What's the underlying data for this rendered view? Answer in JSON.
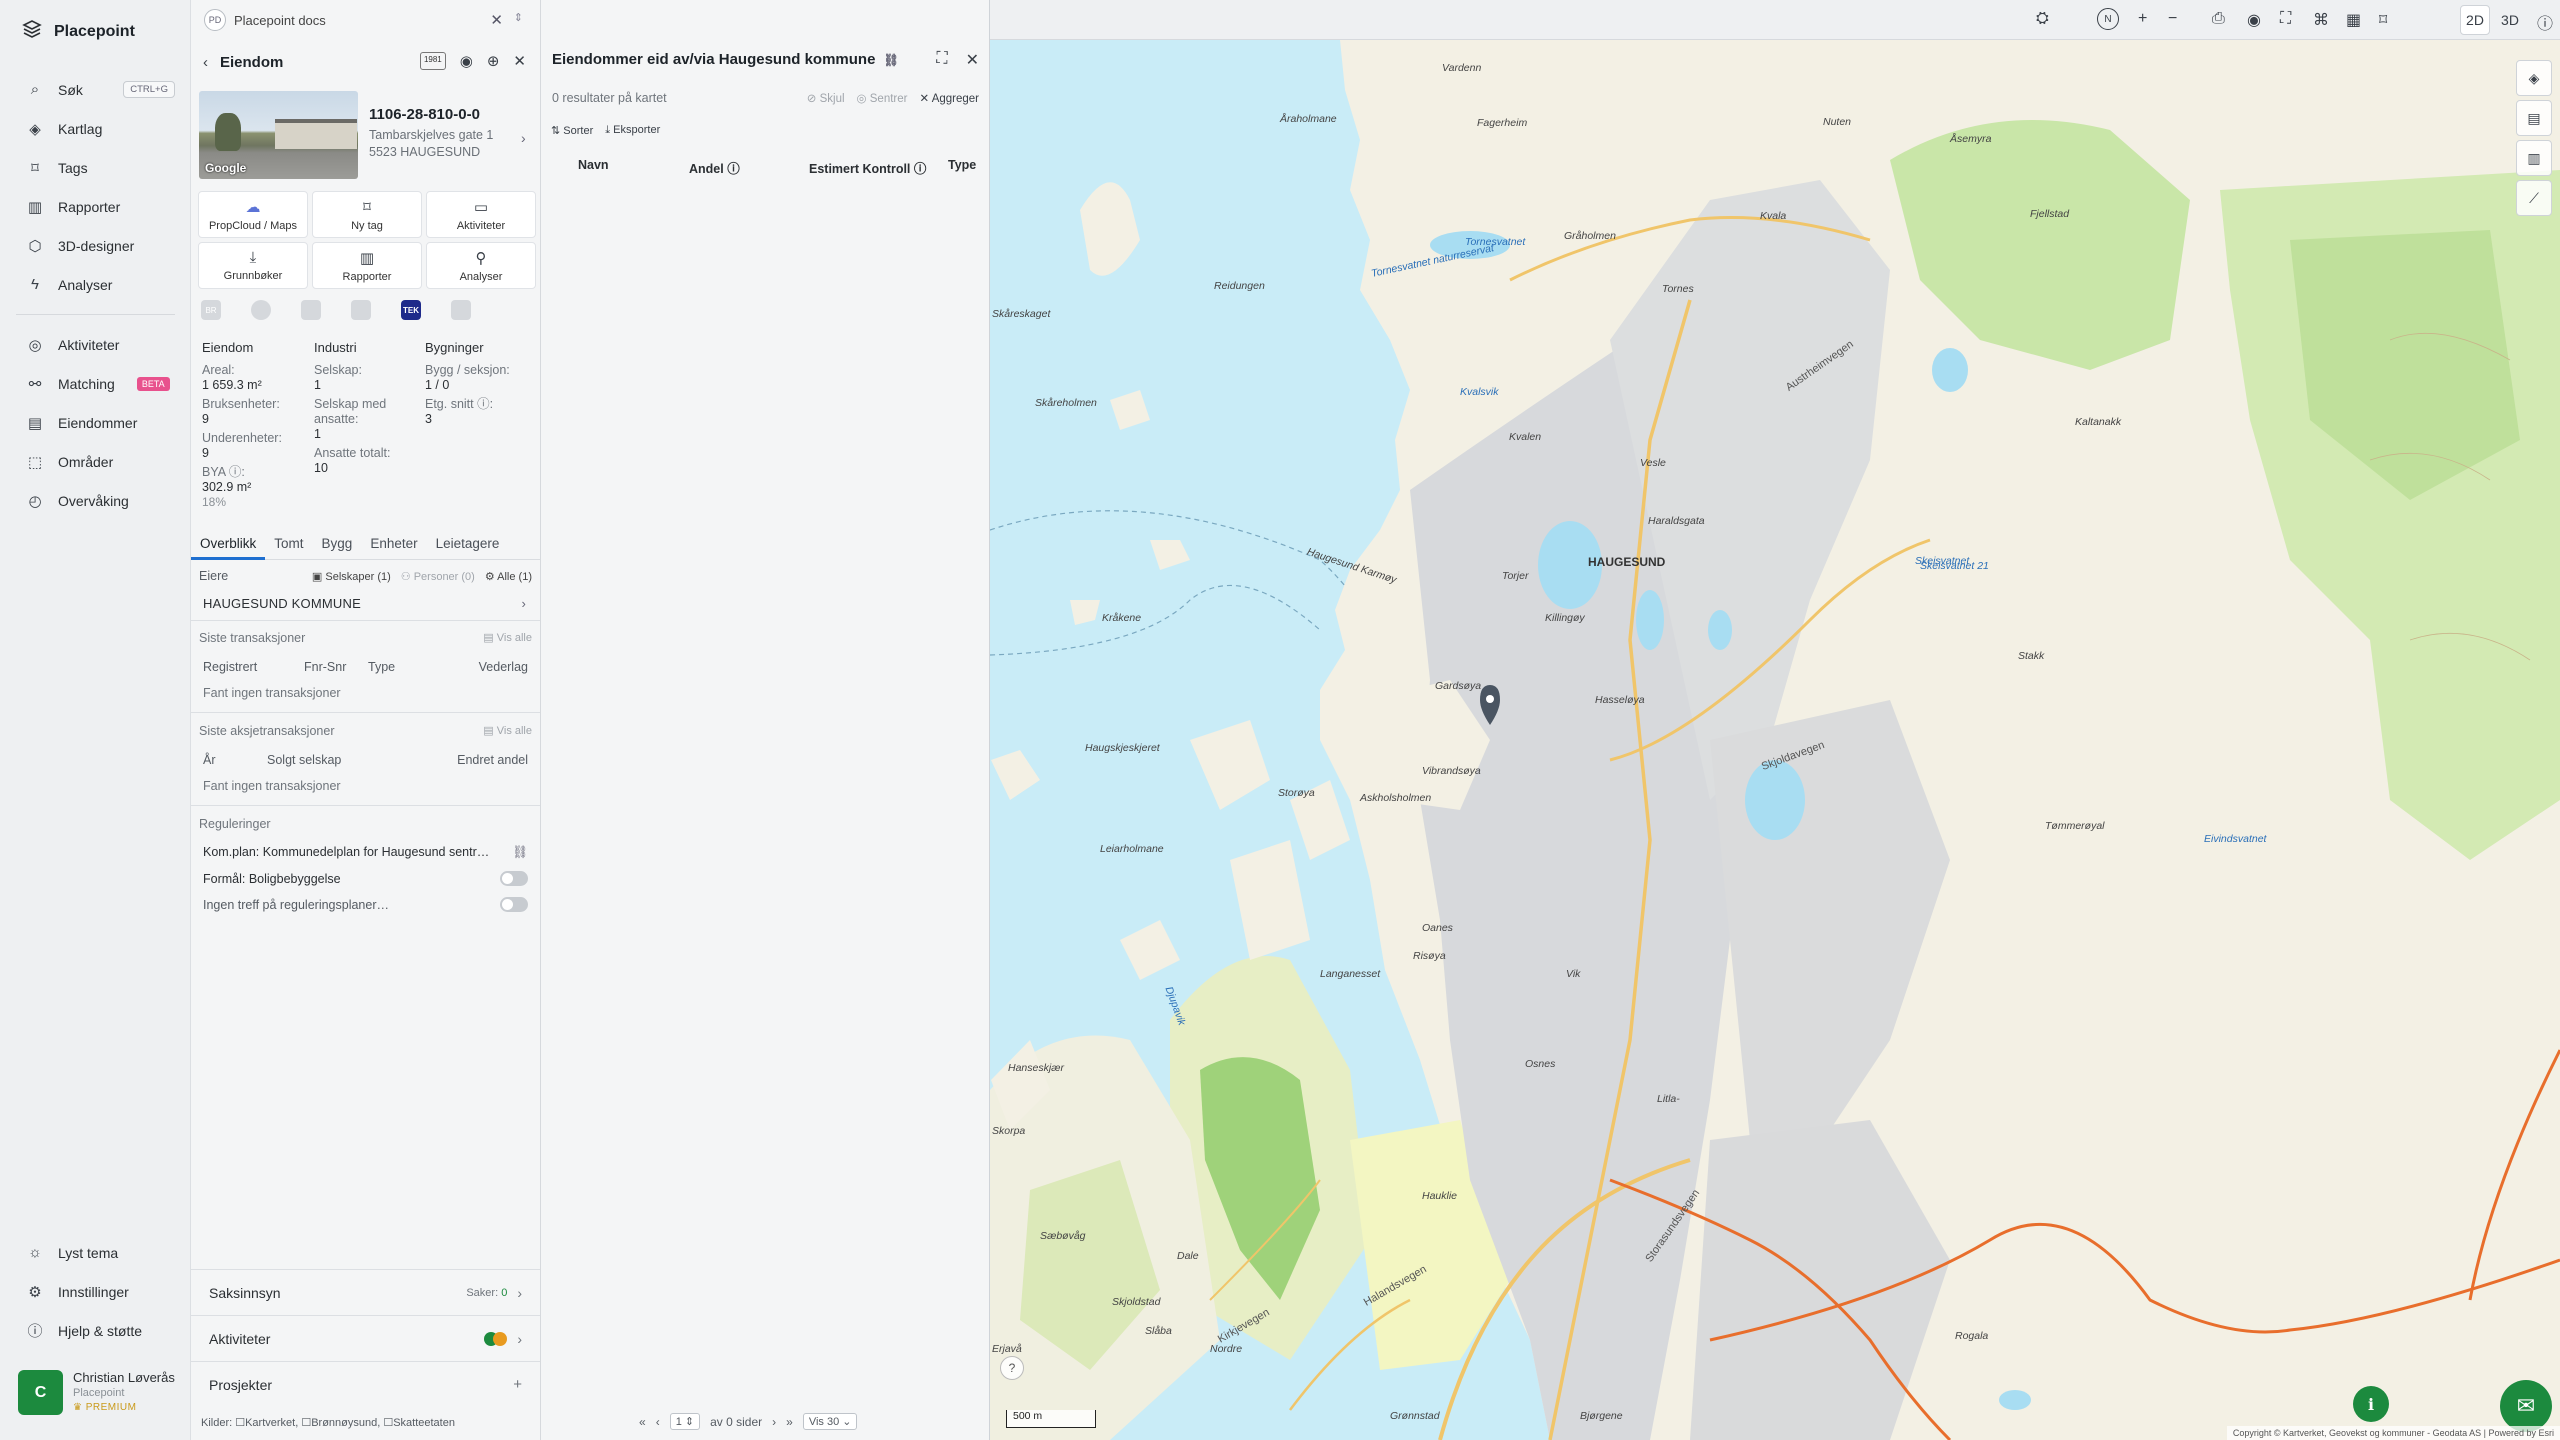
{
  "app": {
    "name": "Placepoint"
  },
  "nav": {
    "items": [
      {
        "label": "Søk",
        "icon": "search-icon",
        "shortcut": "CTRL+G"
      },
      {
        "label": "Kartlag",
        "icon": "layers-icon"
      },
      {
        "label": "Tags",
        "icon": "bookmark-icon"
      },
      {
        "label": "Rapporter",
        "icon": "chart-icon"
      },
      {
        "label": "3D-designer",
        "icon": "cube-icon"
      },
      {
        "label": "Analyser",
        "icon": "bolt-icon"
      }
    ],
    "items2": [
      {
        "label": "Aktiviteter",
        "icon": "activity-icon"
      },
      {
        "label": "Matching",
        "icon": "matching-icon",
        "badge": "BETA"
      },
      {
        "label": "Eiendommer",
        "icon": "building-icon"
      },
      {
        "label": "Områder",
        "icon": "area-icon"
      },
      {
        "label": "Overvåking",
        "icon": "monitor-icon"
      }
    ],
    "bottom": [
      {
        "label": "Lyst tema",
        "icon": "sun-icon"
      },
      {
        "label": "Innstillinger",
        "icon": "gear-icon"
      },
      {
        "label": "Hjelp & støtte",
        "icon": "help-icon"
      }
    ],
    "user": {
      "initial": "C",
      "name": "Christian Løverås",
      "org": "Placepoint",
      "plan": "PREMIUM"
    }
  },
  "doc_tab": {
    "badge": "PD",
    "title": "Placepoint docs"
  },
  "property": {
    "header": "Eiendom",
    "year_tag": "1981",
    "thumb_brand": "Google",
    "gnr": "1106-28-810-0-0",
    "street": "Tambarskjelves gate 1",
    "postal": "5523 HAUGESUND",
    "actions": [
      {
        "label": "PropCloud / Maps",
        "icon": "cloud-icon"
      },
      {
        "label": "Ny tag",
        "icon": "bookmark-icon"
      },
      {
        "label": "Aktiviteter",
        "icon": "chat-icon"
      },
      {
        "label": "Grunnbøker",
        "icon": "download-icon"
      },
      {
        "label": "Rapporter",
        "icon": "chart-icon"
      },
      {
        "label": "Analyser",
        "icon": "pin-icon"
      }
    ],
    "sources": [
      "BR",
      "",
      "",
      "",
      "TEK",
      ""
    ],
    "facts": {
      "eiendom": {
        "title": "Eiendom",
        "areal_label": "Areal:",
        "areal": "1 659.3 m²",
        "bruks_label": "Bruksenheter:",
        "bruks": "9",
        "under_label": "Underenheter:",
        "under": "9",
        "bya_label": "BYA ⓘ:",
        "bya": "302.9 m²",
        "bya_pct": "18%"
      },
      "industri": {
        "title": "Industri",
        "selskap_label": "Selskap:",
        "selskap": "1",
        "ansatte_sel_label": "Selskap med ansatte:",
        "ansatte_sel": "1",
        "ansatte_tot_label": "Ansatte totalt:",
        "ansatte_tot": "10"
      },
      "bygninger": {
        "title": "Bygninger",
        "bygg_label": "Bygg / seksjon:",
        "bygg": "1 / 0",
        "etg_label": "Etg. snitt ⓘ:",
        "etg": "3"
      }
    },
    "tabs": [
      "Overblikk",
      "Tomt",
      "Bygg",
      "Enheter",
      "Leietagere"
    ],
    "owners": {
      "label": "Eiere",
      "selskaper": "Selskaper (1)",
      "personer": "Personer (0)",
      "alle": "Alle (1)",
      "owner": "HAUGESUND KOMMUNE"
    },
    "transactions": {
      "label": "Siste transaksjoner",
      "show_all": "Vis alle",
      "cols": [
        "Registrert",
        "Fnr-Snr",
        "Type",
        "Vederlag"
      ],
      "empty": "Fant ingen transaksjoner"
    },
    "share_tx": {
      "label": "Siste aksjetransaksjoner",
      "show_all": "Vis alle",
      "cols": [
        "År",
        "Solgt selskap",
        "Endret andel"
      ],
      "empty": "Fant ingen transaksjoner"
    },
    "regulations": {
      "label": "Reguleringer",
      "plan": "Kom.plan: Kommunedelplan for Haugesund sentr…",
      "purpose": "Formål: Boligbebyggelse",
      "none": "Ingen treff på reguleringsplaner…"
    },
    "saksinnsyn": {
      "label": "Saksinnsyn",
      "count_label": "Saker:",
      "count": "0"
    },
    "aktiviteter": {
      "label": "Aktiviteter"
    },
    "prosjekter": {
      "label": "Prosjekter"
    },
    "kilder": "Kilder: ☐Kartverket, ☐Brønnøysund, ☐Skatteetaten"
  },
  "results": {
    "title": "Eiendommer eid av/via Haugesund kommune",
    "count": "0 resultater på kartet",
    "hide": "Skjul",
    "center": "Sentrer",
    "aggregate": "Aggreger",
    "sort": "Sorter",
    "export": "Eksporter",
    "columns": [
      "Navn",
      "Andel ⓘ",
      "Estimert Kontroll ⓘ",
      "Type"
    ],
    "pager": {
      "page": "1",
      "of": "av 0 sider",
      "per": "Vis 30"
    }
  },
  "map": {
    "mode_2d": "2D",
    "mode_3d": "3D",
    "scale": "500 m",
    "attribution": "Copyright © Kartverket, Geovekst og kommuner - Geodata AS | Powered by Esri",
    "labels": [
      "Vardenn",
      "Åraholmane",
      "Fagerheim",
      "Nuten",
      "Åsemyra",
      "Kvala",
      "Tornesvatnet",
      "Tornesvatnet naturreservat",
      "Gråholmen",
      "Fjellstad",
      "Reidungen",
      "Tornes",
      "Austrheimvegen",
      "Skåreskaget",
      "Skåreholmen",
      "Kvalsvik",
      "Kvalen",
      "Kaltanakk",
      "Vesle",
      "Haraldsgata",
      "HAUGESUND",
      "Haugesund Karmøy",
      "Torjer",
      "Skeisvatnet",
      "Kråkene",
      "Killingøy",
      "Hasseløya",
      "Gardsøya",
      "Haugskjeskjeret",
      "Vibrandsøya",
      "Storøya",
      "Askholsholmen",
      "Leiarholmane",
      "Skjoldavegen",
      "Eivindsvatnet",
      "Oanes",
      "Risøya",
      "Vik",
      "Langanesset",
      "Hanseskjær",
      "Skorpa",
      "Osnes",
      "Litla-",
      "Storasundsvegen",
      "Hauklie",
      "Sæbøvåg",
      "Skjoldstad",
      "Dale",
      "Kirkjevegen",
      "Nordre",
      "Halandsvegen",
      "Djupavik",
      "Grønnstad",
      "Bjørgene",
      "Slåba",
      "Erjavå",
      "Rogala",
      "Skeisvatnet 21",
      "Stakk",
      "Tømmerøyal"
    ]
  }
}
